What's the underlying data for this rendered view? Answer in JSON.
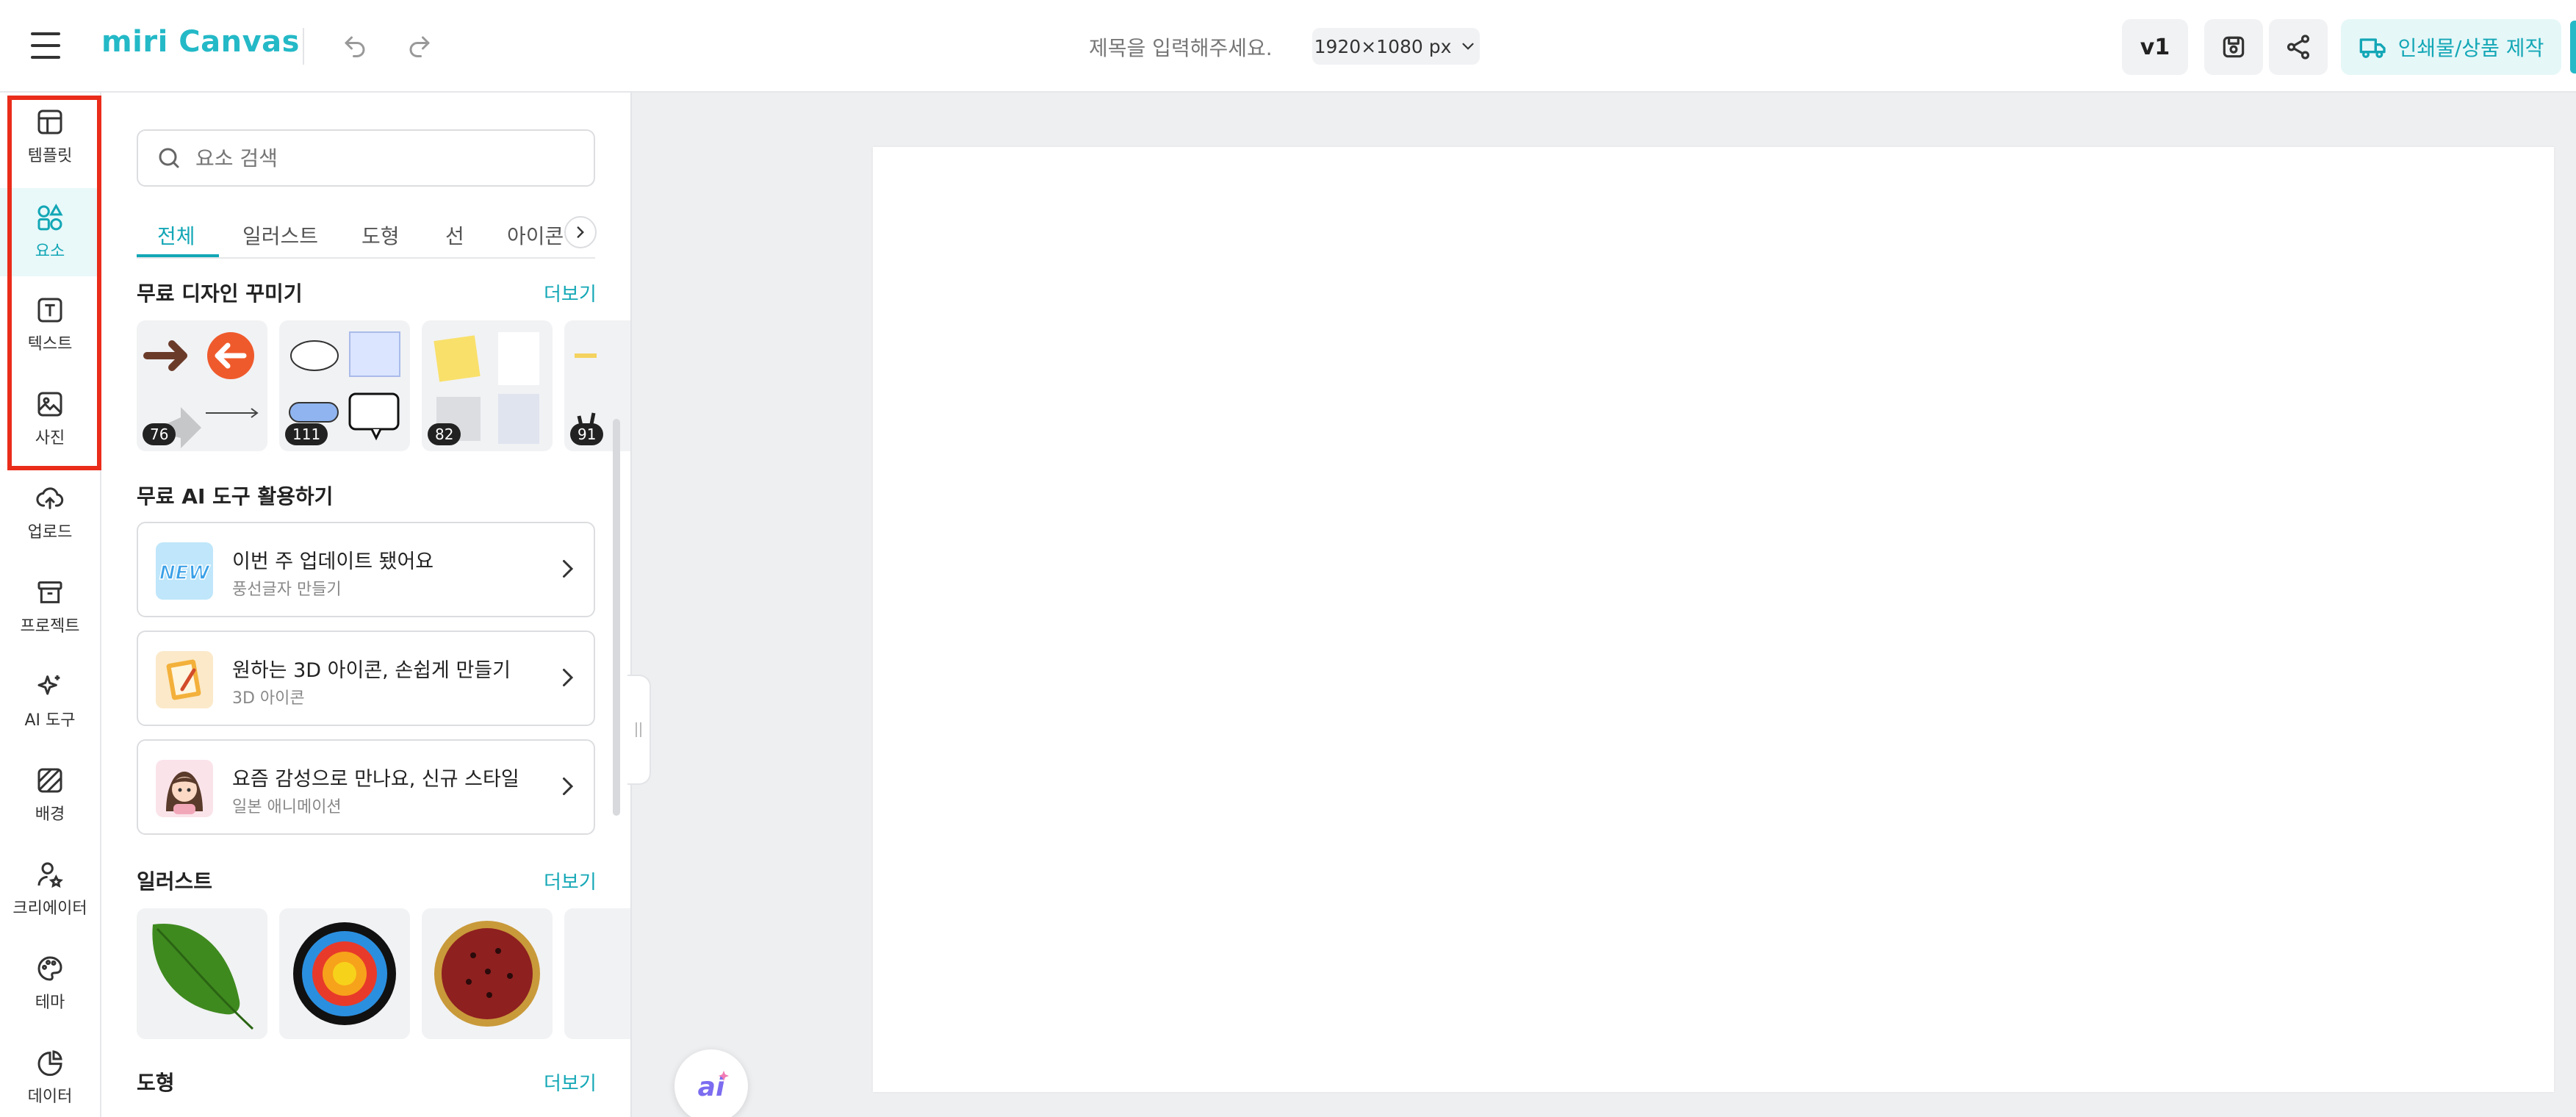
{
  "topbar": {
    "logo": "miri Canvas",
    "title_placeholder": "제목을 입력해주세요.",
    "canvas_size": "1920×1080 px",
    "version": "v1",
    "print_label": "인쇄물/상품 제작"
  },
  "rail": {
    "items": [
      {
        "label": "템플릿",
        "icon": "template-icon"
      },
      {
        "label": "요소",
        "icon": "elements-icon"
      },
      {
        "label": "텍스트",
        "icon": "text-icon"
      },
      {
        "label": "사진",
        "icon": "photo-icon"
      },
      {
        "label": "업로드",
        "icon": "upload-icon"
      },
      {
        "label": "프로젝트",
        "icon": "project-icon"
      },
      {
        "label": "AI 도구",
        "icon": "ai-sparkle-icon"
      },
      {
        "label": "배경",
        "icon": "background-icon"
      },
      {
        "label": "크리에이터",
        "icon": "creator-icon"
      },
      {
        "label": "테마",
        "icon": "palette-icon"
      },
      {
        "label": "데이터",
        "icon": "chart-icon"
      }
    ],
    "active_index": 1
  },
  "panel": {
    "search_placeholder": "요소 검색",
    "tabs": [
      "전체",
      "일러스트",
      "도형",
      "선",
      "아이콘"
    ],
    "active_tab": 0,
    "sections": {
      "free_design": {
        "title": "무료 디자인 꾸미기",
        "more": "더보기",
        "counts": [
          "76",
          "111",
          "82",
          "91"
        ]
      },
      "ai_tools": {
        "title": "무료 AI 도구 활용하기",
        "cards": [
          {
            "title": "이번 주 업데이트 됐어요",
            "subtitle": "풍선글자 만들기"
          },
          {
            "title": "원하는 3D 아이콘, 손쉽게 만들기",
            "subtitle": "3D 아이콘"
          },
          {
            "title": "요즘 감성으로 만나요, 신규 스타일",
            "subtitle": "일본 애니메이션"
          }
        ]
      },
      "illustration": {
        "title": "일러스트",
        "more": "더보기"
      },
      "shapes": {
        "title": "도형",
        "more": "더보기"
      }
    }
  },
  "colors": {
    "accent": "#13a7b6",
    "highlight": "#ea2c1a"
  }
}
